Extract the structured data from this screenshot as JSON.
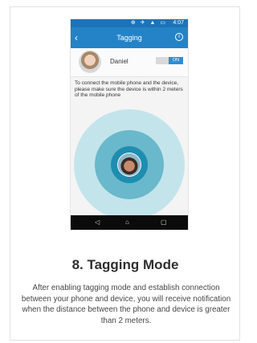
{
  "phone": {
    "status_time": "4:07",
    "status_icons": "⊕ ✈ ▲ ▭",
    "app_title": "Tagging",
    "back_icon": "‹",
    "info_icon": "i",
    "user_name": "Daniel",
    "toggle_label": "ON",
    "instruction": "To connect the mobile phone and the device, please make sure the device is within 2 meters of the mobile phone",
    "nav": {
      "back": "◁",
      "home": "⌂",
      "recent": "▢"
    }
  },
  "feature": {
    "title": "8. Tagging Mode",
    "description": "After enabling tagging mode and establish connection between your phone and device, you will receive notification when the distance between the phone and device is greater than 2 meters."
  }
}
